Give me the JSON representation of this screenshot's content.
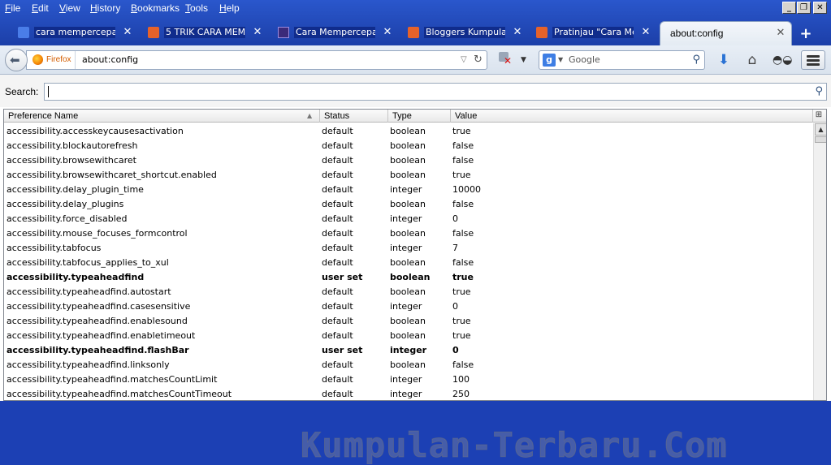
{
  "menubar": {
    "items": [
      {
        "label": "File",
        "accel": "F",
        "rest": "ile"
      },
      {
        "label": "Edit",
        "accel": "E",
        "rest": "dit"
      },
      {
        "label": "View",
        "accel": "V",
        "rest": "iew"
      },
      {
        "label": "History",
        "accel": "H",
        "rest": "istory"
      },
      {
        "label": "Bookmarks",
        "accel": "B",
        "rest": "ookmarks"
      },
      {
        "label": "Tools",
        "accel": "T",
        "rest": "ools"
      },
      {
        "label": "Help",
        "accel": "H",
        "rest": "elp"
      }
    ]
  },
  "window_controls": {
    "minimize": "_",
    "restore": "❐",
    "close": "✕"
  },
  "tabs": [
    {
      "label": "cara mempercepat ...",
      "icon": "google-favicon",
      "color": "#4a7de8"
    },
    {
      "label": "5 TRIK CARA MEM...",
      "icon": "blogger-favicon",
      "color": "#e6622a"
    },
    {
      "label": "Cara Mempercepat ...",
      "icon": "site-favicon",
      "color": "#3b2a7a"
    },
    {
      "label": "Bloggers Kumpulan ...",
      "icon": "blogger-favicon",
      "color": "#e6622a"
    },
    {
      "label": "Pratinjau \"Cara Me...",
      "icon": "blogger-favicon",
      "color": "#e6622a"
    }
  ],
  "active_tab": {
    "label": "about:config"
  },
  "tab_close_glyph": "✕",
  "newtab_glyph": "+",
  "navbar": {
    "identity_label": "Firefox",
    "url": "about:config",
    "search_placeholder": "Google",
    "search_engine_letter": "g"
  },
  "config": {
    "search_label": "Search:",
    "columns": [
      "Preference Name",
      "Status",
      "Type",
      "Value"
    ],
    "rows": [
      {
        "name": "accessibility.accesskeycausesactivation",
        "status": "default",
        "type": "boolean",
        "value": "true"
      },
      {
        "name": "accessibility.blockautorefresh",
        "status": "default",
        "type": "boolean",
        "value": "false"
      },
      {
        "name": "accessibility.browsewithcaret",
        "status": "default",
        "type": "boolean",
        "value": "false"
      },
      {
        "name": "accessibility.browsewithcaret_shortcut.enabled",
        "status": "default",
        "type": "boolean",
        "value": "true"
      },
      {
        "name": "accessibility.delay_plugin_time",
        "status": "default",
        "type": "integer",
        "value": "10000"
      },
      {
        "name": "accessibility.delay_plugins",
        "status": "default",
        "type": "boolean",
        "value": "false"
      },
      {
        "name": "accessibility.force_disabled",
        "status": "default",
        "type": "integer",
        "value": "0"
      },
      {
        "name": "accessibility.mouse_focuses_formcontrol",
        "status": "default",
        "type": "boolean",
        "value": "false"
      },
      {
        "name": "accessibility.tabfocus",
        "status": "default",
        "type": "integer",
        "value": "7"
      },
      {
        "name": "accessibility.tabfocus_applies_to_xul",
        "status": "default",
        "type": "boolean",
        "value": "false"
      },
      {
        "name": "accessibility.typeaheadfind",
        "status": "user set",
        "type": "boolean",
        "value": "true"
      },
      {
        "name": "accessibility.typeaheadfind.autostart",
        "status": "default",
        "type": "boolean",
        "value": "true"
      },
      {
        "name": "accessibility.typeaheadfind.casesensitive",
        "status": "default",
        "type": "integer",
        "value": "0"
      },
      {
        "name": "accessibility.typeaheadfind.enablesound",
        "status": "default",
        "type": "boolean",
        "value": "true"
      },
      {
        "name": "accessibility.typeaheadfind.enabletimeout",
        "status": "default",
        "type": "boolean",
        "value": "true"
      },
      {
        "name": "accessibility.typeaheadfind.flashBar",
        "status": "user set",
        "type": "integer",
        "value": "0"
      },
      {
        "name": "accessibility.typeaheadfind.linksonly",
        "status": "default",
        "type": "boolean",
        "value": "false"
      },
      {
        "name": "accessibility.typeaheadfind.matchesCountLimit",
        "status": "default",
        "type": "integer",
        "value": "100"
      },
      {
        "name": "accessibility.typeaheadfind.matchesCountTimeout",
        "status": "default",
        "type": "integer",
        "value": "250"
      }
    ]
  },
  "watermark": "Kumpulan-Terbaru.Com"
}
